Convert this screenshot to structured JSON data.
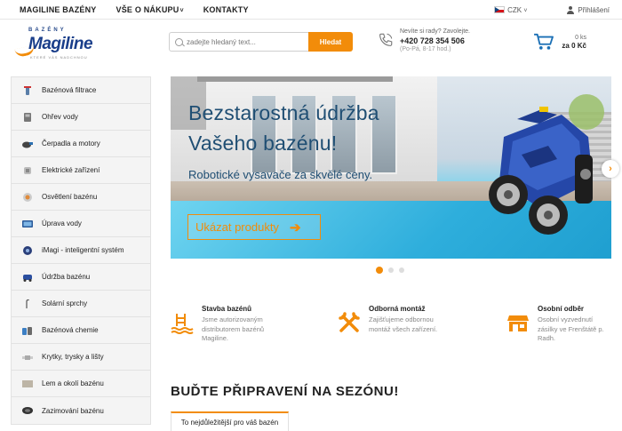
{
  "topnav": {
    "items": [
      {
        "label": "MAGILINE BAZÉNY"
      },
      {
        "label": "VŠE O NÁKUPU",
        "caret": "˅"
      },
      {
        "label": "KONTAKTY"
      }
    ],
    "currency": "CZK",
    "currency_caret": "˅",
    "login": "Přihlášení"
  },
  "logo": {
    "top": "BAZÉNY",
    "name": "Magiline",
    "tagline": "KTERÉ VÁS NADCHNOU"
  },
  "search": {
    "placeholder": "zadejte hledaný text...",
    "button": "Hledat"
  },
  "contact": {
    "question": "Nevíte si rady? Zavolejte.",
    "phone": "+420 728 354 506",
    "hours": "(Po-Pá, 8-17 hod.)"
  },
  "cart": {
    "count": "0 ks",
    "price": "za 0 Kč"
  },
  "categories": [
    {
      "label": "Bazénová filtrace",
      "icon": "filter-icon"
    },
    {
      "label": "Ohřev vody",
      "icon": "heater-icon"
    },
    {
      "label": "Čerpadla a motory",
      "icon": "pump-icon"
    },
    {
      "label": "Elektrické zařízení",
      "icon": "electric-icon"
    },
    {
      "label": "Osvětlení bazénu",
      "icon": "light-icon"
    },
    {
      "label": "Úprava vody",
      "icon": "water-treatment-icon"
    },
    {
      "label": "iMagi - inteligentní systém",
      "icon": "smart-system-icon"
    },
    {
      "label": "Údržba bazénu",
      "icon": "robot-icon"
    },
    {
      "label": "Solární sprchy",
      "icon": "shower-icon"
    },
    {
      "label": "Bazénová chemie",
      "icon": "chemistry-icon"
    },
    {
      "label": "Krytky, trysky a lišty",
      "icon": "nozzle-icon"
    },
    {
      "label": "Lem a okolí bazénu",
      "icon": "edge-icon"
    },
    {
      "label": "Zazimování bazénu",
      "icon": "winter-icon"
    }
  ],
  "banner": {
    "line1": "Bezstarostná údržba",
    "line2": "Vašeho bazénu!",
    "subtitle": "Robotické vysavače za skvělé ceny.",
    "cta": "Ukázat produkty",
    "cta_arrow": "➔",
    "next_arrow": "›",
    "slides": 3,
    "active_slide": 1
  },
  "features": [
    {
      "title": "Stavba bazénů",
      "text": "Jsme autorizovaným distributorem bazénů Magiline."
    },
    {
      "title": "Odborná montáž",
      "text": "Zajišťujeme odbornou montáž všech zařízení."
    },
    {
      "title": "Osobní odběr",
      "text": "Osobní vyzvednutí zásilky ve Frenštátě p. Radh."
    }
  ],
  "section": {
    "title": "BUĎTE PŘIPRAVENÍ NA SEZÓNU!",
    "tab": "To nejdůležitější pro váš bazén"
  },
  "colors": {
    "accent": "#f28c0a",
    "brand_blue": "#1a3e8a",
    "banner_text": "#1f4e73"
  }
}
